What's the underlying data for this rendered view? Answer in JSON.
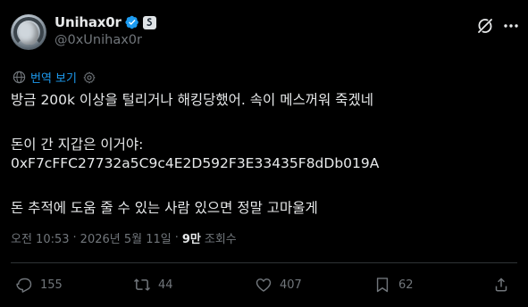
{
  "author": {
    "display_name": "Unihax0r",
    "handle": "@0xUnihax0r"
  },
  "translate": {
    "label": "번역 보기"
  },
  "tweet": {
    "lines": [
      "방금 200k 이상을 털리거나 해킹당했어. 속이 메스꺼워 죽겠네",
      "돈이 간 지갑은 이거야:",
      "0xF7cFFC27732a5C9c4E2D592F3E33435F8dDb019A",
      "돈 추적에 도움 줄 수 있는 사람 있으면 정말 고마울게"
    ]
  },
  "meta": {
    "time": "오전 10:53",
    "separator": "·",
    "date": "2026년 5월 11일",
    "views_count": "9만",
    "views_label": "조회수"
  },
  "actions": {
    "replies": "155",
    "reposts": "44",
    "likes": "407",
    "bookmarks": "62"
  },
  "colors": {
    "background": "#000000",
    "text": "#e7e9ea",
    "secondary": "#71767b",
    "accent": "#1d9bf0",
    "divider": "#2f3336"
  },
  "icons": [
    "verified-badge-icon",
    "affiliate-badge-icon",
    "grok-icon",
    "more-icon",
    "globe-icon",
    "settings-icon",
    "reply-icon",
    "repost-icon",
    "like-icon",
    "bookmark-icon",
    "share-icon"
  ]
}
